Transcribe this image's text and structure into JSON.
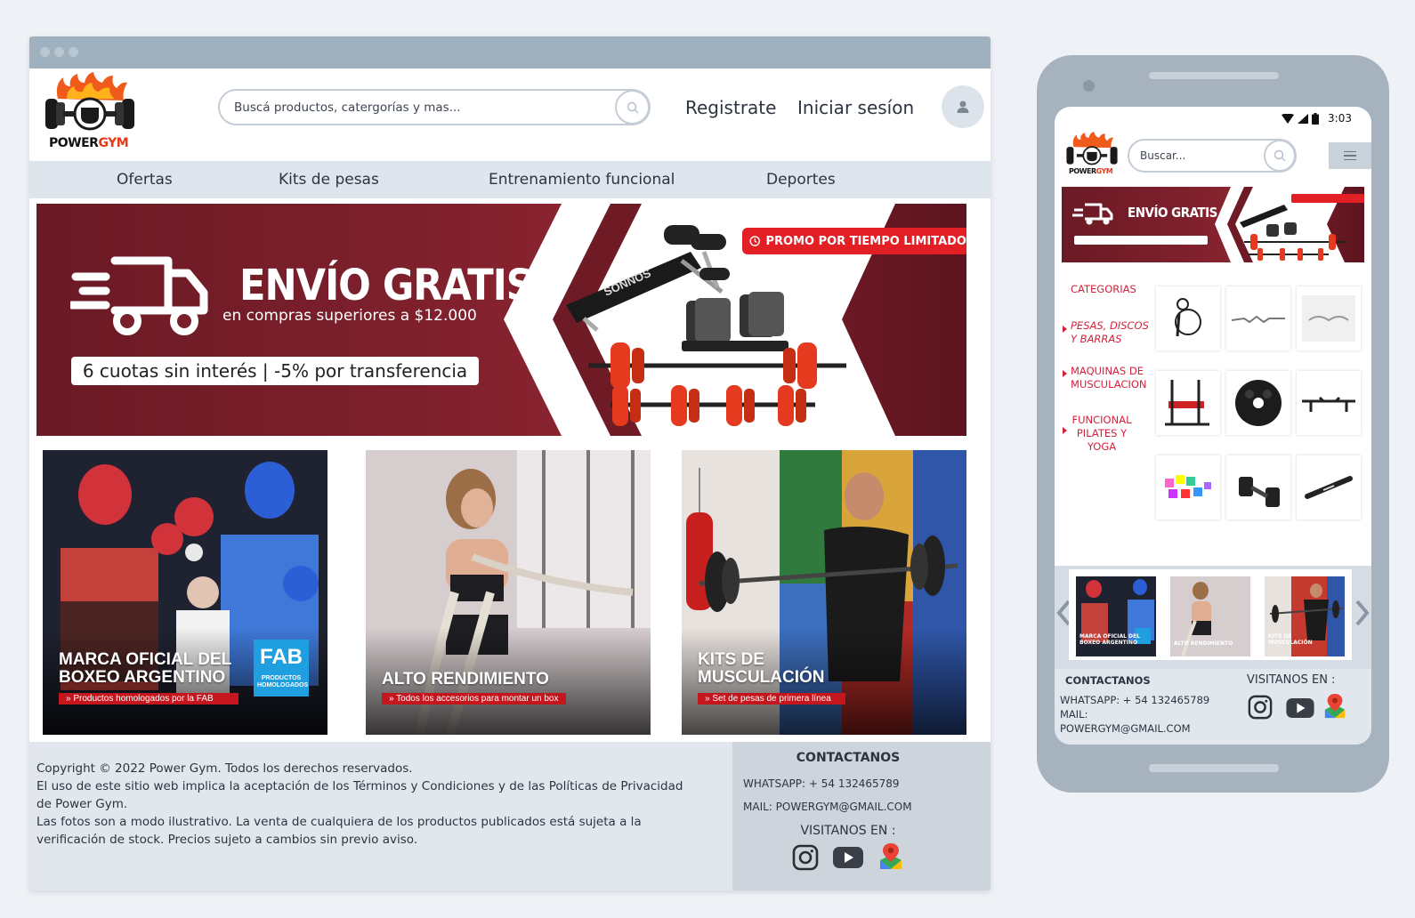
{
  "desktop": {
    "logo": {
      "word1": "POWER",
      "word2": "GYM"
    },
    "search": {
      "placeholder": "Buscá productos, catergorías y mas..."
    },
    "header": {
      "register": "Registrate",
      "login": "Iniciar sesíon"
    },
    "nav": [
      "Ofertas",
      "Kits de pesas",
      "Entrenamiento funcional",
      "Deportes"
    ],
    "banner": {
      "title": "ENVÍO GRATIS",
      "subtitle": "en compras superiores a $12.000",
      "pill": "6 cuotas sin interés | -5% por transferencia",
      "promo": "PROMO POR TIEMPO LIMITADO",
      "bench_brand": "SONNOS"
    },
    "cards": [
      {
        "title_1": "MARCA OFICIAL DEL",
        "title_2": "BOXEO ARGENTINO",
        "sub": "Productos homologados por la FAB",
        "fab": "FAB",
        "fab_sub": "PRODUCTOS HOMOLOGADOS"
      },
      {
        "title_1": "",
        "title_2": "ALTO RENDIMIENTO",
        "sub": "Todos los accesorios para montar un box"
      },
      {
        "title_1": "KITS DE",
        "title_2": "MUSCULACIÓN",
        "sub": "Set de pesas de primera línea"
      }
    ],
    "footer": {
      "line1": "Copyright © 2022 Power Gym. Todos los derechos reservados.",
      "line2": "El uso de este sitio web implica la aceptación de los Términos y Condiciones y de las Políticas de Privacidad de Power Gym.",
      "line3": "Las fotos son a modo ilustrativo. La venta de cualquiera de los productos publicados está sujeta a la verificación de stock. Precios sujeto a cambios sin previo aviso.",
      "contact_title": "CONTACTANOS",
      "whatsapp": "WHATSAPP: + 54 132465789",
      "mail": "MAIL: POWERGYM@GMAIL.COM",
      "visit": "VISITANOS EN :"
    }
  },
  "mobile": {
    "status_time": "3:03",
    "search": {
      "placeholder": "Buscar..."
    },
    "categories_title": "CATEGORIAS",
    "categories": [
      {
        "line1": "PESAS, DISCOS",
        "line2": "Y BARRAS"
      },
      {
        "line1": "MAQUINAS DE",
        "line2": "MUSCULACION"
      },
      {
        "line1": "FUNCIONAL",
        "line2": "PILATES Y",
        "line3": "YOGA"
      }
    ],
    "footer": {
      "contact_title": "CONTACTANOS",
      "whatsapp": "WHATSAPP: + 54 132465789",
      "mail_label": "MAIL:",
      "mail": "POWERGYM@GMAIL.COM",
      "visit": "VISITANOS EN :"
    }
  },
  "colors": {
    "brand_red": "#c4161c",
    "banner_bg": "#7a1f2b",
    "promo_red": "#e21f24",
    "nav_bg": "#dfe5ec",
    "accent_text": "#d4213a"
  },
  "icons": [
    "search-icon",
    "user-icon",
    "instagram-icon",
    "youtube-icon",
    "maps-icon",
    "menu-icon",
    "wifi-icon",
    "signal-icon",
    "battery-icon",
    "chevron-left-icon",
    "chevron-right-icon",
    "truck-icon",
    "clock-icon"
  ]
}
